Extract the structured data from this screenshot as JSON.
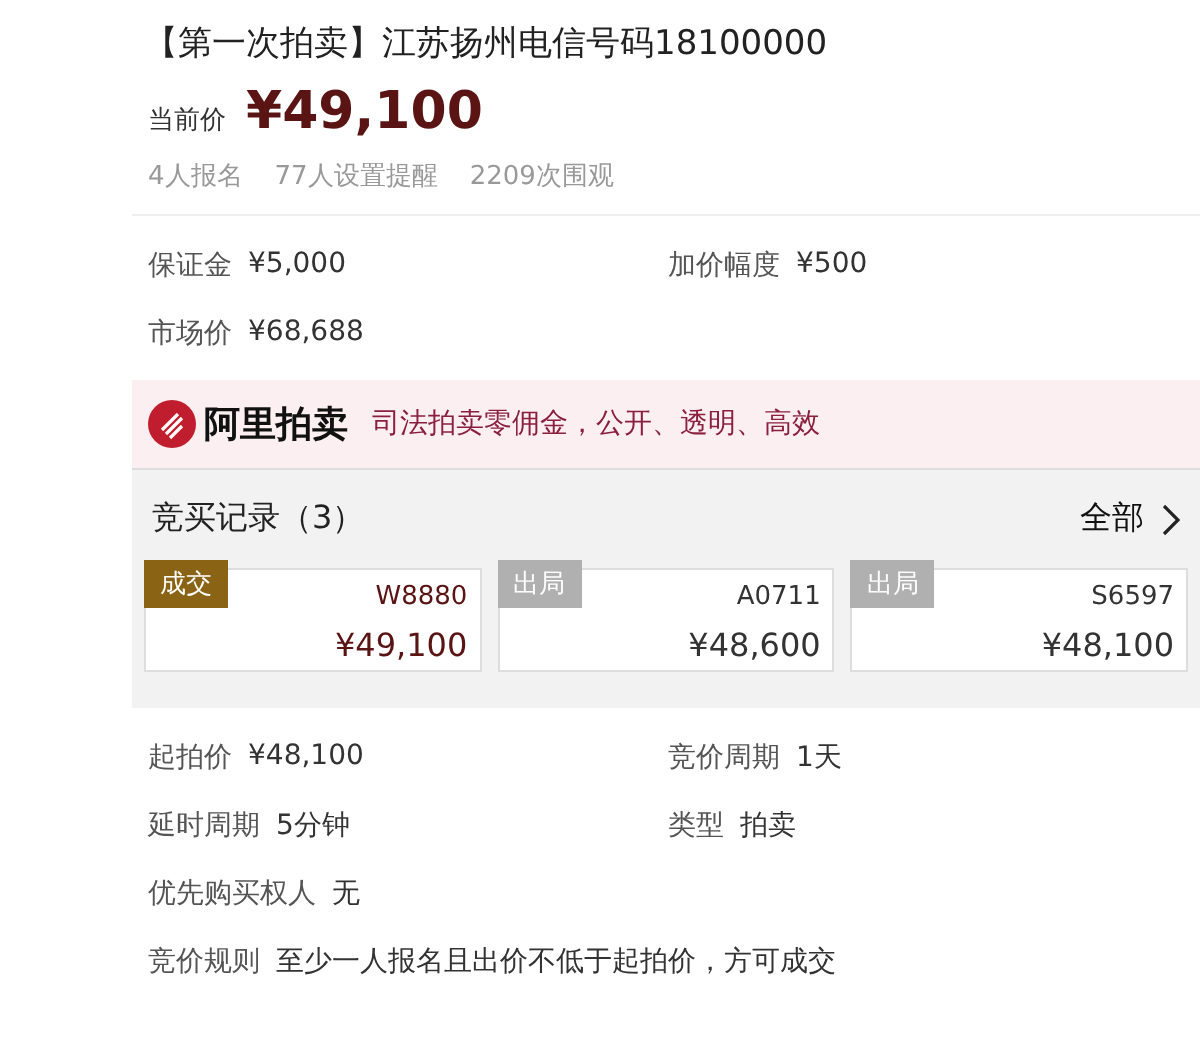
{
  "title": "【第一次拍卖】江苏扬州电信号码18100000",
  "current_price": {
    "label": "当前价",
    "value": "¥49,100"
  },
  "stats": [
    "4人报名",
    "77人设置提醒",
    "2209次围观"
  ],
  "info": [
    {
      "label": "保证金",
      "value": "¥5,000"
    },
    {
      "label": "加价幅度",
      "value": "¥500"
    },
    {
      "label": "市场价",
      "value": "¥68,688"
    }
  ],
  "banner": {
    "brand": "阿里拍卖",
    "slogan": "司法拍卖零佣金，公开、透明、高效"
  },
  "bid_records": {
    "title": "竞买记录（3）",
    "all_link": "全部",
    "bids": [
      {
        "kind": "deal",
        "status": "成交",
        "bidder": "W8880",
        "price": "¥49,100"
      },
      {
        "kind": "out",
        "status": "出局",
        "bidder": "A0711",
        "price": "¥48,600"
      },
      {
        "kind": "out",
        "status": "出局",
        "bidder": "S6597",
        "price": "¥48,100"
      }
    ]
  },
  "details": [
    {
      "label": "起拍价",
      "value": "¥48,100"
    },
    {
      "label": "竞价周期",
      "value": "1天"
    },
    {
      "label": "延时周期",
      "value": "5分钟"
    },
    {
      "label": "类型",
      "value": "拍卖"
    },
    {
      "label": "优先购买权人",
      "value": "无"
    },
    {
      "label": "竞价规则",
      "value": "至少一人报名且出价不低于起拍价，方可成交"
    }
  ]
}
